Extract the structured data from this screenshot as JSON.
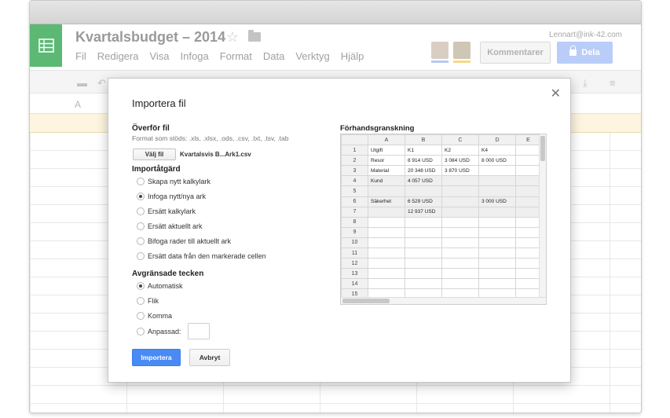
{
  "app": {
    "doc_title": "Kvartalsbudget – 2014",
    "user_email": "Lennart@ink-42.com",
    "menu": [
      "Fil",
      "Redigera",
      "Visa",
      "Infoga",
      "Format",
      "Data",
      "Verktyg",
      "Hjälp"
    ],
    "comment_label": "Kommentarer",
    "share_label": "Dela",
    "column_a_letter": "A"
  },
  "dialog": {
    "title": "Importera fil",
    "upload": {
      "title": "Överför fil",
      "hint": "Format som stöds: .xls, .xlsx, .ods, .csv, .txt, .tsv, .tab",
      "choose_label": "Välj fil",
      "file_name": "Kvartalsvis B...Ark1.csv"
    },
    "import_action": {
      "title": "Importåtgärd",
      "options": [
        {
          "label": "Skapa nytt kalkylark",
          "selected": false
        },
        {
          "label": "Infoga nytt/nya ark",
          "selected": true
        },
        {
          "label": "Ersätt kalkylark",
          "selected": false
        },
        {
          "label": "Ersätt aktuellt ark",
          "selected": false
        },
        {
          "label": "Bifoga rader till aktuellt ark",
          "selected": false
        },
        {
          "label": "Ersätt data från den markerade cellen",
          "selected": false
        }
      ]
    },
    "separator": {
      "title": "Avgränsade tecken",
      "options": [
        {
          "label": "Automatisk",
          "selected": true
        },
        {
          "label": "Flik",
          "selected": false
        },
        {
          "label": "Komma",
          "selected": false
        },
        {
          "label": "Anpassad:",
          "selected": false
        }
      ]
    },
    "import_label": "Importera",
    "cancel_label": "Avbryt",
    "preview": {
      "title": "Förhandsgranskning",
      "columns": [
        "A",
        "B",
        "C",
        "D",
        "E"
      ],
      "rows": [
        {
          "n": "1",
          "cells": [
            "Utgift",
            "K1",
            "K2",
            "K4",
            ""
          ],
          "shaded": false
        },
        {
          "n": "2",
          "cells": [
            "Resor",
            "8 914 USD",
            "3 084 USD",
            "8 000 USD",
            ""
          ],
          "shaded": false
        },
        {
          "n": "3",
          "cells": [
            "Material",
            "20 348 USD",
            "3 870 USD",
            "",
            ""
          ],
          "shaded": false
        },
        {
          "n": "4",
          "cells": [
            "Kund",
            "4 057 USD",
            "",
            "",
            ""
          ],
          "shaded": true
        },
        {
          "n": "5",
          "cells": [
            "",
            "",
            "",
            "",
            ""
          ],
          "shaded": true
        },
        {
          "n": "6",
          "cells": [
            "Säkerhet",
            "6 529 USD",
            "",
            "3 000 USD",
            ""
          ],
          "shaded": true
        },
        {
          "n": "7",
          "cells": [
            "",
            "12 937 USD",
            "",
            "",
            ""
          ],
          "shaded": true
        },
        {
          "n": "8",
          "cells": [
            "",
            "",
            "",
            "",
            ""
          ],
          "shaded": false
        },
        {
          "n": "9",
          "cells": [
            "",
            "",
            "",
            "",
            ""
          ],
          "shaded": false
        },
        {
          "n": "10",
          "cells": [
            "",
            "",
            "",
            "",
            ""
          ],
          "shaded": false
        },
        {
          "n": "11",
          "cells": [
            "",
            "",
            "",
            "",
            ""
          ],
          "shaded": false
        },
        {
          "n": "12",
          "cells": [
            "",
            "",
            "",
            "",
            ""
          ],
          "shaded": false
        },
        {
          "n": "13",
          "cells": [
            "",
            "",
            "",
            "",
            ""
          ],
          "shaded": false
        },
        {
          "n": "14",
          "cells": [
            "",
            "",
            "",
            "",
            ""
          ],
          "shaded": false
        },
        {
          "n": "15",
          "cells": [
            "",
            "",
            "",
            "",
            ""
          ],
          "shaded": false
        }
      ]
    }
  }
}
